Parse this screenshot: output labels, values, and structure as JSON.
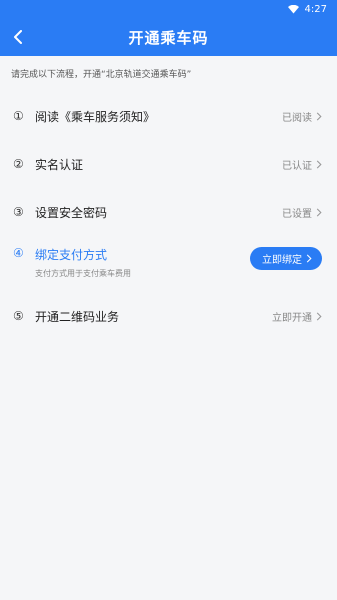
{
  "statusbar": {
    "time": "4:27"
  },
  "header": {
    "title": "开通乘车码"
  },
  "notice": "请完成以下流程，开通“北京轨道交通乘车码”",
  "steps": [
    {
      "num": "①",
      "label": "阅读《乘车服务须知》",
      "status": "已阅读"
    },
    {
      "num": "②",
      "label": "实名认证",
      "status": "已认证"
    },
    {
      "num": "③",
      "label": "设置安全密码",
      "status": "已设置"
    },
    {
      "num": "④",
      "label": "绑定支付方式",
      "sub": "支付方式用于支付乘车费用",
      "action": "立即绑定"
    },
    {
      "num": "⑤",
      "label": "开通二维码业务",
      "status": "立即开通"
    }
  ],
  "colors": {
    "primary": "#2a7cf4",
    "background": "#f5f6f8"
  },
  "icons": {
    "back": "chevron-left-icon",
    "wifi": "wifi-icon",
    "arrow": "chevron-right-icon"
  }
}
